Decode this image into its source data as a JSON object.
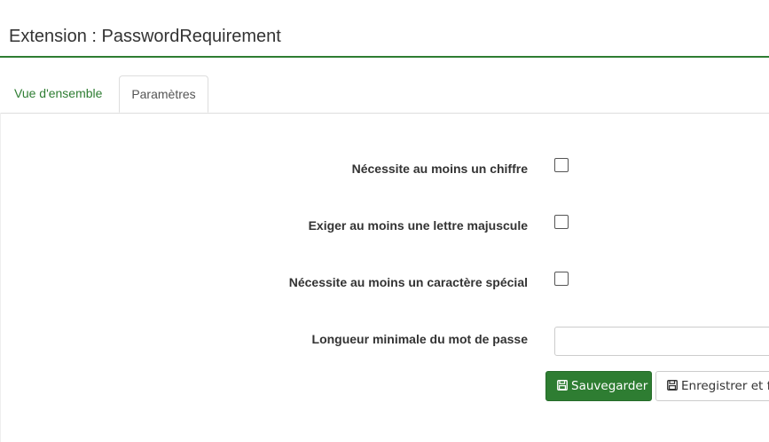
{
  "header": {
    "title": "Extension : PasswordRequirement"
  },
  "tabs": [
    {
      "label": "Vue d'ensemble",
      "active": false
    },
    {
      "label": "Paramètres",
      "active": true
    }
  ],
  "form": {
    "fields": [
      {
        "label": "Nécessite au moins un chiffre",
        "type": "checkbox",
        "checked": false
      },
      {
        "label": "Exiger au moins une lettre majuscule",
        "type": "checkbox",
        "checked": false
      },
      {
        "label": "Nécessite au moins un caractère spécial",
        "type": "checkbox",
        "checked": false
      },
      {
        "label": "Longueur minimale du mot de passe",
        "type": "text",
        "value": "",
        "placeholder": ""
      }
    ],
    "buttons": {
      "save_label": "Sauvegarder",
      "save_close_label": "Enregistrer et fermer"
    }
  },
  "colors": {
    "accent": "#2e7d32",
    "border": "#dddddd"
  },
  "icons": {
    "save": "floppy-disk-icon"
  }
}
